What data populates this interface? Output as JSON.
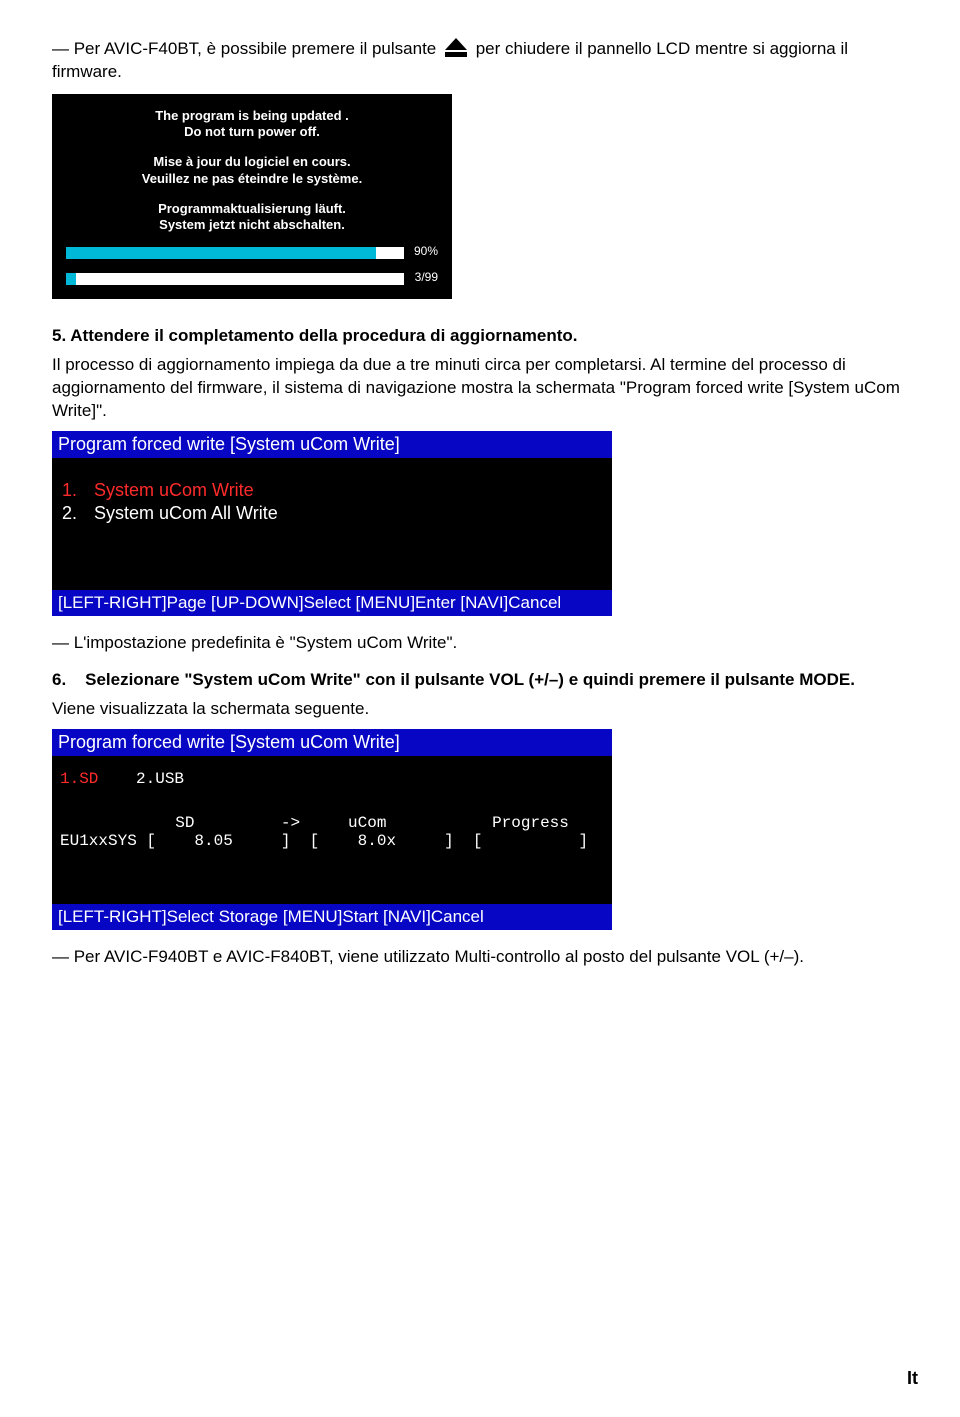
{
  "intro": {
    "before_icon": "— Per AVIC-F40BT, è possibile premere il pulsante",
    "after_icon": "per chiudere il pannello LCD mentre si aggiorna il firmware."
  },
  "screen1": {
    "msg_en_1": "The program is being updated .",
    "msg_en_2": "Do not turn power off.",
    "msg_fr_1": "Mise à jour du logiciel en cours.",
    "msg_fr_2": "Veuillez ne pas éteindre le système.",
    "msg_de_1": "Programmaktualisierung läuft.",
    "msg_de_2": "System jetzt nicht abschalten.",
    "bar1_pct": "90%",
    "bar1_fill": 90,
    "bar2_pct": "3/99",
    "bar2_fill": 3
  },
  "step5": {
    "text": "5.   Attendere il completamento della procedura di aggiornamento.",
    "p1": "Il processo di aggiornamento impiega da due a tre minuti circa per completarsi. Al termine del processo di aggiornamento del firmware, il sistema di navigazione mostra la schermata \"Program forced write [System uCom Write]\"."
  },
  "screen2": {
    "title": "Program forced write [System uCom Write]",
    "item1_num": "1.",
    "item1_txt": "System uCom Write",
    "item2_num": "2.",
    "item2_txt": "System uCom All Write",
    "footer": "[LEFT-RIGHT]Page  [UP-DOWN]Select  [MENU]Enter  [NAVI]Cancel"
  },
  "after_screen2_note": "— L'impostazione predefinita è \"System uCom Write\".",
  "step6": {
    "num": "6.",
    "bold": "Selezionare \"System uCom Write\" con il pulsante VOL (+/–) e quindi premere il pulsante MODE.",
    "after": "Viene visualizzata la schermata seguente."
  },
  "screen3": {
    "title": "Program forced write [System uCom Write]",
    "sd": "1.SD",
    "usb": "2.USB",
    "col_head": "            SD         ->     uCom           Progress",
    "data_row": "EU1xxSYS [    8.05     ]  [    8.0x     ]  [          ]",
    "footer": "[LEFT-RIGHT]Select Storage [MENU]Start [NAVI]Cancel"
  },
  "after_screen3_note": "— Per AVIC-F940BT e AVIC-F840BT, viene utilizzato Multi-controllo al posto del pulsante VOL (+/–).",
  "footer_lang": "It"
}
